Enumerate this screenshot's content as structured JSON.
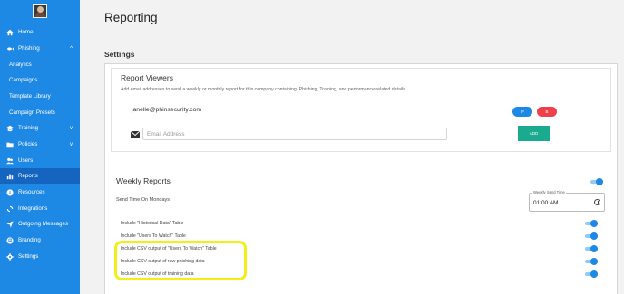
{
  "page": {
    "title": "Reporting"
  },
  "sidebar": {
    "items": [
      {
        "label": "Home",
        "icon": "home-icon"
      },
      {
        "label": "Phishing",
        "icon": "fish-icon",
        "chevron": "^"
      },
      {
        "label": "Analytics"
      },
      {
        "label": "Campaigns"
      },
      {
        "label": "Template Library"
      },
      {
        "label": "Campaign Presets"
      },
      {
        "label": "Training",
        "icon": "mortarboard-icon",
        "chevron": "v"
      },
      {
        "label": "Policies",
        "icon": "folder-icon",
        "chevron": "v"
      },
      {
        "label": "Users",
        "icon": "users-icon"
      },
      {
        "label": "Reports",
        "icon": "chart-icon"
      },
      {
        "label": "Resources",
        "icon": "info-icon"
      },
      {
        "label": "Integrations",
        "icon": "sync-icon"
      },
      {
        "label": "Outgoing Messages",
        "icon": "send-icon"
      },
      {
        "label": "Branding",
        "icon": "flag-icon"
      },
      {
        "label": "Settings",
        "icon": "gear-icon"
      }
    ]
  },
  "settings": {
    "title": "Settings",
    "report_viewers": {
      "title": "Report Viewers",
      "description": "Add email addresses to send a weekly or monthly report for this company containing: Phishing, Training, and performance related details.",
      "email": "janelle@phinsecurity.com",
      "btn_if": "IF",
      "btn_x": "B",
      "placeholder": "Email Address",
      "add_label": "ADD"
    },
    "weekly": {
      "title": "Weekly Reports",
      "send_time_label": "Send Time On Mondays",
      "time_field_label": "Weekly Send Time",
      "time_value": "01:00 AM",
      "options": [
        {
          "label": "Include \"Historical Data\" Table",
          "enabled": true
        },
        {
          "label": "Include \"Users To Watch\" Table",
          "enabled": true
        },
        {
          "label": "Include CSV output of \"Users To Watch\" Table",
          "enabled": true
        },
        {
          "label": "Include CSV output of raw phishing data",
          "enabled": true
        },
        {
          "label": "Include CSV output of training data",
          "enabled": true
        }
      ]
    }
  },
  "colors": {
    "sidebar": "#1e88e5",
    "active": "#1565c0",
    "add": "#1aaa8f",
    "danger": "#ef3f4a",
    "highlight": "#f2ee1a"
  }
}
